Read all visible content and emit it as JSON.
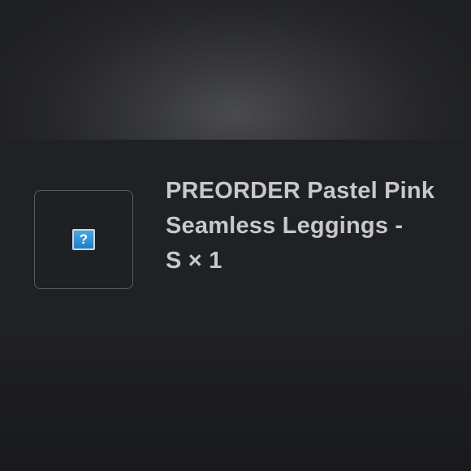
{
  "order_item": {
    "image_placeholder": "?",
    "title_line1": "PREORDER Pastel Pink",
    "title_line2": "Seamless Leggings -",
    "title_line3": "S × 1"
  },
  "icons": {
    "thumbnail": "broken-image-icon"
  }
}
